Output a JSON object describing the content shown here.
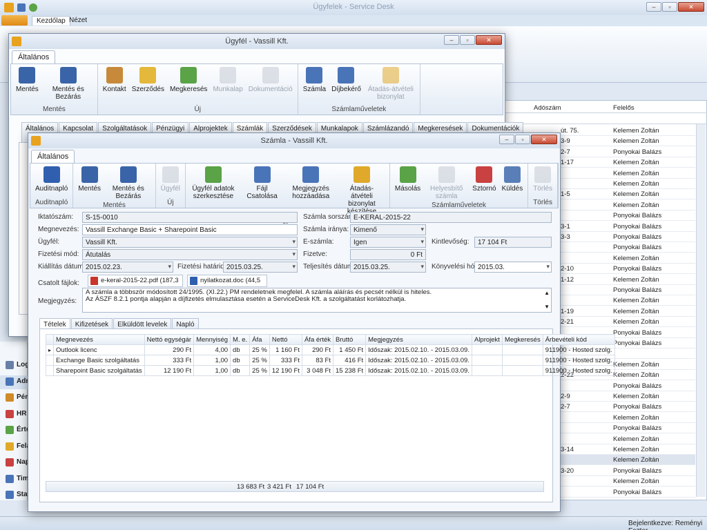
{
  "main": {
    "title": "Ügyfelek - Service Desk",
    "ribbon_tabs": [
      "Kezdőlap",
      "Nézet"
    ],
    "grid_headers": [
      "Adószám",
      "Felelős"
    ],
    "background_rows": [
      {
        "adoszam": "út. 75.",
        "felelos": "Kelemen Zoltán"
      },
      {
        "adoszam": "3-9",
        "felelos": "Kelemen Zoltán"
      },
      {
        "adoszam": "2-7",
        "felelos": "Ponyokai Balázs"
      },
      {
        "adoszam": "1-17",
        "felelos": "Kelemen Zoltán"
      },
      {
        "adoszam": "",
        "felelos": "Kelemen Zoltán"
      },
      {
        "adoszam": "",
        "felelos": "Kelemen Zoltán"
      },
      {
        "adoszam": "1-5",
        "felelos": "Kelemen Zoltán"
      },
      {
        "adoszam": "",
        "felelos": "Kelemen Zoltán"
      },
      {
        "adoszam": "",
        "felelos": "Ponyokai Balázs"
      },
      {
        "adoszam": "3-1",
        "felelos": "Ponyokai Balázs"
      },
      {
        "adoszam": "3-3",
        "felelos": "Ponyokai Balázs"
      },
      {
        "adoszam": "",
        "felelos": "Ponyokai Balázs"
      },
      {
        "adoszam": "",
        "felelos": "Kelemen Zoltán"
      },
      {
        "adoszam": "2-10",
        "felelos": "Ponyokai Balázs"
      },
      {
        "adoszam": "1-12",
        "felelos": "Kelemen Zoltán"
      },
      {
        "adoszam": "",
        "felelos": "Ponyokai Balázs"
      },
      {
        "adoszam": "",
        "felelos": "Kelemen Zoltán"
      },
      {
        "adoszam": "1-19",
        "felelos": "Kelemen Zoltán"
      },
      {
        "adoszam": "2-21",
        "felelos": "Kelemen Zoltán"
      },
      {
        "adoszam": "",
        "felelos": "Ponyokai Balázs"
      },
      {
        "adoszam": "2-11",
        "felelos": "Ponyokai Balázs"
      },
      {
        "adoszam": "",
        "felelos": ""
      },
      {
        "adoszam": "",
        "felelos": "Kelemen Zoltán"
      },
      {
        "adoszam": "2-22",
        "felelos": "Kelemen Zoltán"
      },
      {
        "adoszam": "",
        "felelos": "Ponyokai Balázs"
      },
      {
        "adoszam": "2-9",
        "felelos": "Kelemen Zoltán"
      },
      {
        "adoszam": "2-7",
        "felelos": "Ponyokai Balázs"
      },
      {
        "adoszam": "",
        "felelos": "Kelemen Zoltán"
      },
      {
        "adoszam": "",
        "felelos": "Ponyokai Balázs"
      },
      {
        "adoszam": "",
        "felelos": "Kelemen Zoltán"
      },
      {
        "adoszam": "3-14",
        "felelos": "Kelemen Zoltán"
      },
      {
        "adoszam": "",
        "felelos": "Kelemen Zoltán"
      },
      {
        "adoszam": "3-20",
        "felelos": "Ponyokai Balázs"
      },
      {
        "adoszam": "",
        "felelos": "Kelemen Zoltán"
      },
      {
        "adoszam": "",
        "felelos": "Ponyokai Balázs"
      }
    ],
    "left_nav": [
      "Log",
      "Adm",
      "Pén",
      "HR",
      "Érté",
      "Fela",
      "Nap",
      "Tim",
      "Stat"
    ],
    "status": "Bejelentkezve: Reményi Eszter"
  },
  "ugyfel": {
    "title": "Ügyfél - Vassill Kft.",
    "ribbon_tab": "Általános",
    "groups": [
      {
        "label": "Mentés",
        "buttons": [
          {
            "label": "Mentés",
            "icon": "save-icon",
            "dis": false
          },
          {
            "label": "Mentés és Bezárás",
            "icon": "save-close-icon",
            "dis": false
          }
        ]
      },
      {
        "label": "Új",
        "buttons": [
          {
            "label": "Kontakt",
            "icon": "contact-icon",
            "dis": false
          },
          {
            "label": "Szerződés",
            "icon": "contract-icon",
            "dis": false
          },
          {
            "label": "Megkeresés",
            "icon": "request-icon",
            "dis": false
          },
          {
            "label": "Munkalap",
            "icon": "worksheet-icon",
            "dis": true
          },
          {
            "label": "Dokumentáció",
            "icon": "document-icon",
            "dis": true
          }
        ]
      },
      {
        "label": "Számlaműveletek",
        "buttons": [
          {
            "label": "Számla",
            "icon": "invoice-icon",
            "dis": false
          },
          {
            "label": "Díjbekérő",
            "icon": "fee-request-icon",
            "dis": false
          },
          {
            "label": "Átadás-átvételi bizonylat",
            "icon": "handover-icon",
            "dis": true
          }
        ]
      }
    ],
    "tabs": [
      "Általános",
      "Kapcsolat",
      "Szolgáltatások",
      "Pénzügyi adatok",
      "Alprojektek",
      "Számlák",
      "Szerződések",
      "Munkalapok",
      "Számlázandó tételek",
      "Megkeresések",
      "Dokumentációk"
    ],
    "active_tab": 5
  },
  "szamla": {
    "title": "Számla - Vassill Kft.",
    "ribbon_tab": "Általános",
    "groups": [
      {
        "label": "Auditnapló",
        "buttons": [
          {
            "label": "Auditnapló",
            "icon": "audit-log-icon",
            "dis": false
          }
        ]
      },
      {
        "label": "Mentés",
        "buttons": [
          {
            "label": "Mentés",
            "icon": "save-icon",
            "dis": false
          },
          {
            "label": "Mentés és Bezárás",
            "icon": "save-close-icon",
            "dis": false
          }
        ]
      },
      {
        "label": "Új",
        "buttons": [
          {
            "label": "Ügyfél",
            "icon": "client-icon",
            "dis": true
          }
        ]
      },
      {
        "label": "Egyéb",
        "buttons": [
          {
            "label": "Ügyfél adatok szerkesztése",
            "icon": "edit-client-icon",
            "dis": false
          },
          {
            "label": "Fájl Csatolása",
            "icon": "attach-icon",
            "dis": false
          },
          {
            "label": "Megjegyzés hozzáadása",
            "icon": "comment-icon",
            "dis": false
          },
          {
            "label": "Átadás-átvételi bizonylat készítése",
            "icon": "handover-icon",
            "dis": false
          }
        ]
      },
      {
        "label": "Számlaműveletek",
        "buttons": [
          {
            "label": "Másolás",
            "icon": "copy-icon",
            "dis": false
          },
          {
            "label": "Helyesbítő számla",
            "icon": "correction-icon",
            "dis": true
          },
          {
            "label": "Sztornó",
            "icon": "storno-icon",
            "dis": false
          },
          {
            "label": "Küldés",
            "icon": "send-icon",
            "dis": false
          }
        ]
      },
      {
        "label": "Törlés",
        "buttons": [
          {
            "label": "Törlés",
            "icon": "delete-icon",
            "dis": true
          }
        ]
      }
    ],
    "form": {
      "iktatoszam_label": "Iktatószám:",
      "iktatoszam": "S-15-0010",
      "sorszam_label": "Számla sorszáma:",
      "sorszam": "E-KERAL-2015-22",
      "megnevezes_label": "Megnevezés:",
      "megnevezes": "Vassill Exchange Basic + Sharepoint Basic",
      "iranya_label": "Számla iránya:",
      "iranya": "Kimenő",
      "ugyfel_label": "Ügyfél:",
      "ugyfel": "Vassill Kft.",
      "eszamla_label": "E-számla:",
      "eszamla": "Igen",
      "kintlevoseg_label": "Kintlevőség:",
      "kintlevoseg": "17 104 Ft",
      "fizmod_label": "Fizetési mód:",
      "fizmod": "Átutalás",
      "fizetve_label": "Fizetve:",
      "fizetve": "0 Ft",
      "kiallitas_label": "Kiállítás dátuma:",
      "kiallitas": "2015.02.23.",
      "hatarido_label": "Fizetési határidő:",
      "hatarido": "2015.03.25.",
      "teljesites_label": "Teljesítés dátuma:",
      "teljesites": "2015.03.25.",
      "honap_label": "Könyvelési hónap:",
      "honap": "2015.03.",
      "fajlok_label": "Csatolt fájlok:",
      "fajl1": "e-keral-2015-22.pdf (187,3 kB)",
      "fajl2": "nyilatkozat.doc (44,5 kB)",
      "megjegyzes_label": "Megjegyzés:",
      "megjegyzes1": "A számla a többször módosított 24/1995. (XI.22.) PM rendeletnek megfelel. A számla aláírás és pecsét nélkül is hiteles.",
      "megjegyzes2": "Az ÁSZF 8.2.1 pontja alapján a díjfizetés elmulasztása esetén a ServiceDesk Kft. a szolgáltatást korlátozhatja."
    },
    "subtabs": [
      "Tételek",
      "Kifizetések",
      "Elküldött levelek",
      "Napló"
    ],
    "active_subtab": 0,
    "columns": [
      "Megnevezés",
      "Nettó egységár",
      "Mennyiség",
      "M. e.",
      "Áfa",
      "Nettó",
      "Áfa érték",
      "Bruttó",
      "Megjegyzés",
      "Alprojekt",
      "Megkeresés",
      "Árbevételi kód"
    ],
    "rows": [
      [
        "Outlook licenc",
        "290 Ft",
        "4,00",
        "db",
        "25 %",
        "1 160 Ft",
        "290 Ft",
        "1 450 Ft",
        "Időszak: 2015.02.10. - 2015.03.09.",
        "",
        "",
        "911900 - Hosted szolg."
      ],
      [
        "Exchange Basic szolgáltatás",
        "333 Ft",
        "1,00",
        "db",
        "25 %",
        "333 Ft",
        "83 Ft",
        "416 Ft",
        "Időszak: 2015.02.10. - 2015.03.09.",
        "",
        "",
        "911900 - Hosted szolg."
      ],
      [
        "Sharepoint Basic szolgáltatás",
        "12 190 Ft",
        "1,00",
        "db",
        "25 %",
        "12 190 Ft",
        "3 048 Ft",
        "15 238 Ft",
        "Időszak: 2015.02.10. - 2015.03.09.",
        "",
        "",
        "911900 - Hosted szolg."
      ]
    ],
    "totals": {
      "netto": "13 683 Ft",
      "afa": "3 421 Ft",
      "brutto": "17 104 Ft"
    }
  }
}
